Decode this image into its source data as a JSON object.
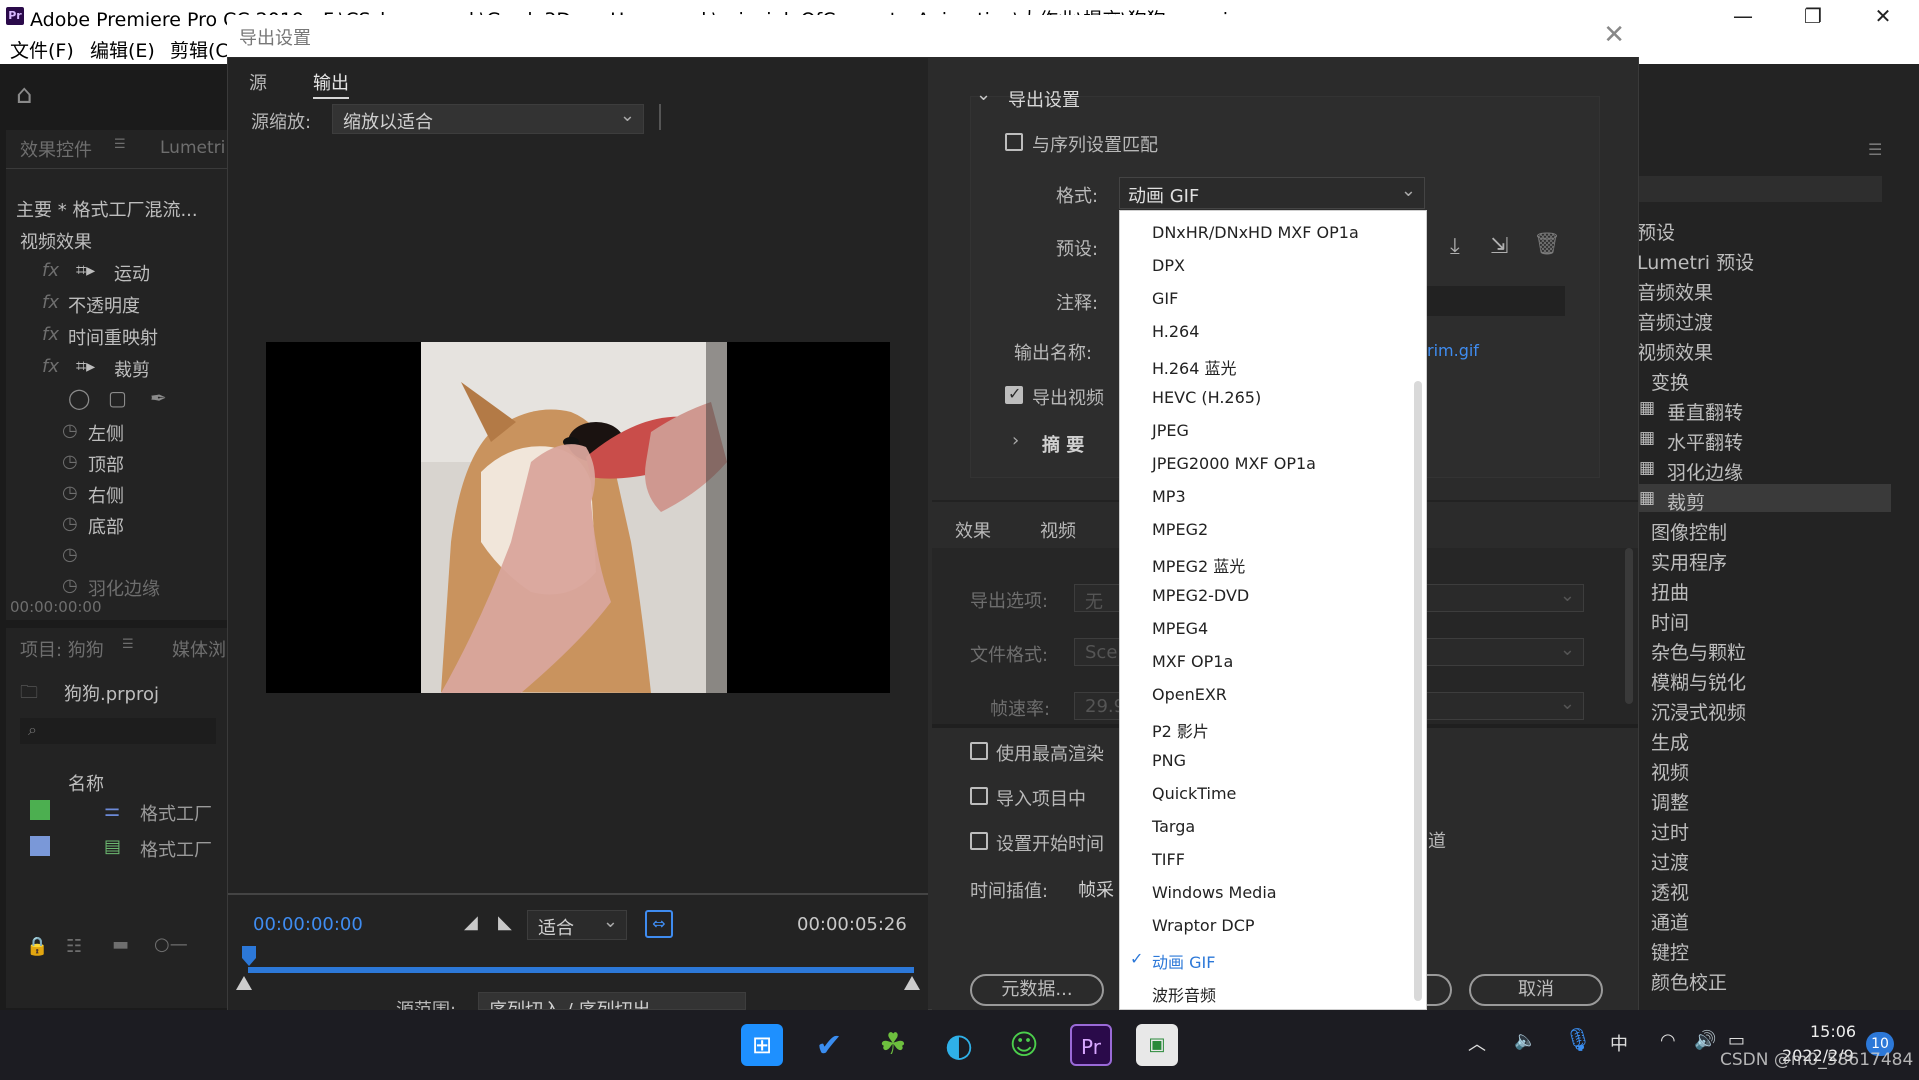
{
  "app": {
    "title": "Adobe Premiere Pro CC 2019 - F:\\CS_homework\\Grade3DownHomework\\principleOfComputerAnimation\\大作业\\提交\\狗狗.prproj",
    "logo": "Pr",
    "menu": [
      "文件(F)",
      "编辑(E)",
      "剪辑(C)"
    ]
  },
  "left_panel": {
    "tabs": [
      "效果控件",
      "Lumetri"
    ],
    "clip_label": "主要 * 格式工厂混流...",
    "section": "视频效果",
    "effects": [
      "运动",
      "不透明度",
      "时间重映射",
      "裁剪"
    ],
    "crop_props": [
      "左侧",
      "顶部",
      "右侧",
      "底部",
      "",
      "羽化边缘"
    ],
    "timecode": "00:00:00:00"
  },
  "project_panel": {
    "tabs": [
      "项目: 狗狗",
      "媒体浏"
    ],
    "file": "狗狗.prproj",
    "col_name": "名称",
    "rows": [
      "格式工厂",
      "格式工厂"
    ]
  },
  "dialog": {
    "title": "导出设置",
    "tabs": [
      "源",
      "输出"
    ],
    "source_scale_label": "源缩放:",
    "source_scale_value": "缩放以适合",
    "timecode_start": "00:00:00:00",
    "timecode_end": "00:00:05:26",
    "fit_value": "适合",
    "source_range_label": "源范围:",
    "source_range_value": "序列切入 / 序列切出",
    "export_settings": {
      "heading": "导出设置",
      "match_sequence": "与序列设置匹配",
      "format_label": "格式:",
      "format_value": "动画 GIF",
      "preset_label": "预设:",
      "comments_label": "注释:",
      "output_name_label": "输出名称:",
      "output_name_value": "rim.gif",
      "export_video": "导出视频",
      "summary": "摘 要"
    },
    "lower_tabs": [
      "效果",
      "视频"
    ],
    "export_options_label": "导出选项:",
    "export_options_value": "无",
    "file_format_label": "文件格式:",
    "file_format_value": "Scen",
    "frame_rate_label": "帧速率:",
    "frame_rate_value": "29.9",
    "use_max_render": "使用最高渲染",
    "import_into_project": "导入项目中",
    "set_start_time": "设置开始时间",
    "alpha_channel_tail": "道",
    "time_interp_label": "时间插值:",
    "time_interp_value": "帧采",
    "metadata_button": "元数据...",
    "cancel_button": "取消"
  },
  "format_list": {
    "items": [
      "DNxHR/DNxHD MXF OP1a",
      "DPX",
      "GIF",
      "H.264",
      "H.264 蓝光",
      "HEVC (H.265)",
      "JPEG",
      "JPEG2000 MXF OP1a",
      "MP3",
      "MPEG2",
      "MPEG2 蓝光",
      "MPEG2-DVD",
      "MPEG4",
      "MXF OP1a",
      "OpenEXR",
      "P2 影片",
      "PNG",
      "QuickTime",
      "Targa",
      "TIFF",
      "Windows Media",
      "Wraptor DCP",
      "动画 GIF",
      "波形音频"
    ],
    "selected": "动画 GIF"
  },
  "effects_panel": {
    "items": [
      "预设",
      "Lumetri 预设",
      "音频效果",
      "音频过渡",
      "视频效果",
      "变换",
      "垂直翻转",
      "水平翻转",
      "羽化边缘",
      "裁剪",
      "图像控制",
      "实用程序",
      "扭曲",
      "时间",
      "杂色与颗粒",
      "模糊与锐化",
      "沉浸式视频",
      "生成",
      "视频",
      "调整",
      "过时",
      "过渡",
      "透视",
      "通道",
      "键控",
      "颜色校正"
    ]
  },
  "taskbar": {
    "time": "15:06",
    "date": "2022/2/9",
    "ime": "中",
    "badge": "10",
    "watermark": "CSDN @m0_58617484"
  }
}
